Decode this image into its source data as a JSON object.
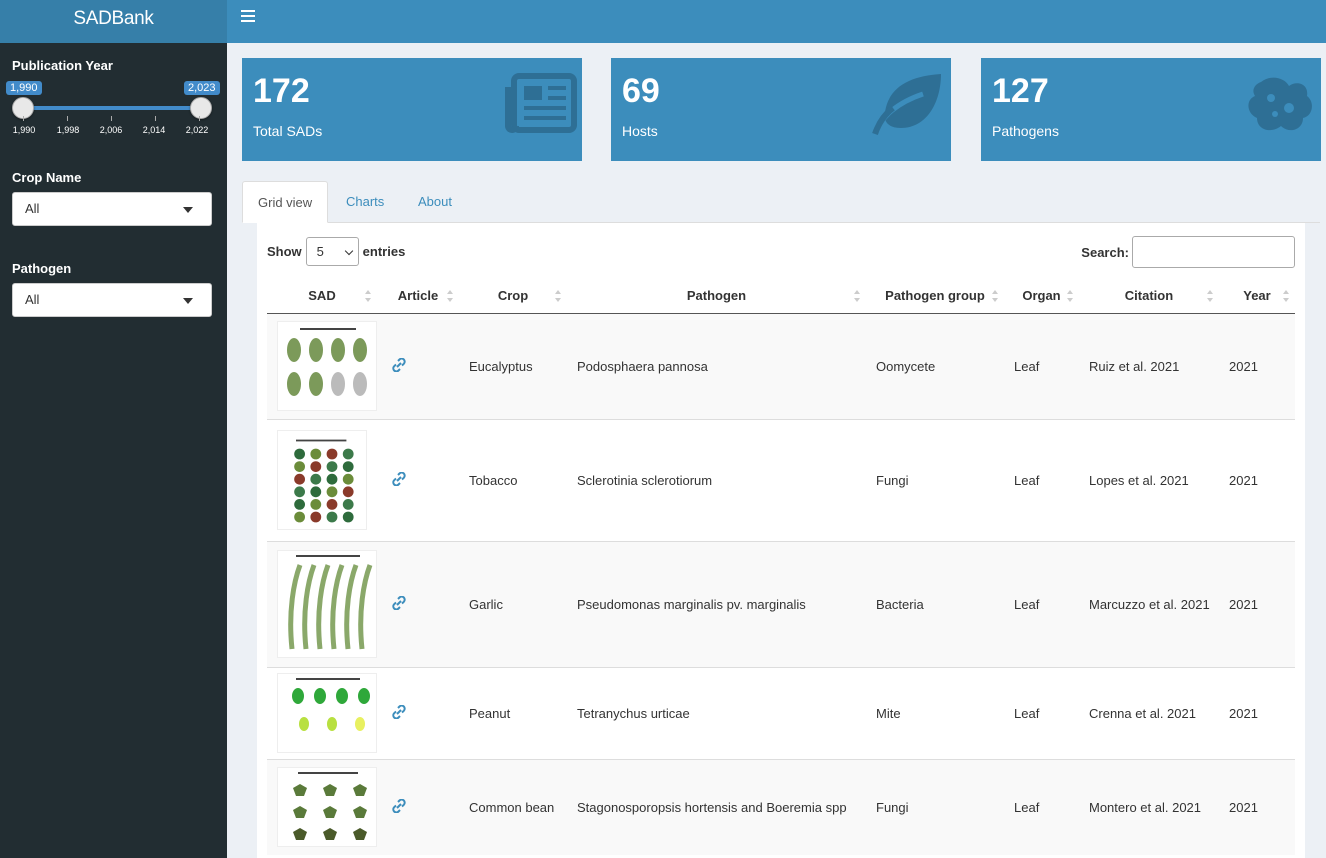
{
  "brand": "SADBank",
  "sidebar": {
    "year_label": "Publication Year",
    "year_min": "1,990",
    "year_max": "2,023",
    "ticks": [
      "1,990",
      "1,998",
      "2,006",
      "2,014",
      "2,022"
    ],
    "crop_label": "Crop Name",
    "crop_value": "All",
    "pathogen_label": "Pathogen",
    "pathogen_value": "All"
  },
  "boxes": [
    {
      "value": "172",
      "label": "Total SADs",
      "icon": "newspaper-icon"
    },
    {
      "value": "69",
      "label": "Hosts",
      "icon": "leaf-icon"
    },
    {
      "value": "127",
      "label": "Pathogens",
      "icon": "bacterium-icon"
    }
  ],
  "tabs": [
    "Grid view",
    "Charts",
    "About"
  ],
  "table": {
    "show_label": "Show",
    "entries_value": "5",
    "entries_label": "entries",
    "search_label": "Search:",
    "columns": [
      "SAD",
      "Article",
      "Crop",
      "Pathogen",
      "Pathogen group",
      "Organ",
      "Citation",
      "Year"
    ],
    "rows": [
      {
        "crop": "Eucalyptus",
        "pathogen": "Podosphaera pannosa",
        "group": "Oomycete",
        "organ": "Leaf",
        "citation": "Ruiz et al. 2021",
        "year": "2021"
      },
      {
        "crop": "Tobacco",
        "pathogen": "Sclerotinia sclerotiorum",
        "group": "Fungi",
        "organ": "Leaf",
        "citation": "Lopes et al. 2021",
        "year": "2021"
      },
      {
        "crop": "Garlic",
        "pathogen": "Pseudomonas marginalis pv. marginalis",
        "group": "Bacteria",
        "organ": "Leaf",
        "citation": "Marcuzzo et al. 2021",
        "year": "2021"
      },
      {
        "crop": "Peanut",
        "pathogen": "Tetranychus urticae",
        "group": "Mite",
        "organ": "Leaf",
        "citation": "Crenna et al. 2021",
        "year": "2021"
      },
      {
        "crop": "Common bean",
        "pathogen": "Stagonosporopsis hortensis and Boeremia spp",
        "group": "Fungi",
        "organ": "Leaf",
        "citation": "Montero et al. 2021",
        "year": "2021"
      }
    ]
  },
  "colors": {
    "header": "#3c8dbc",
    "brand": "#367fa9",
    "sidebar": "#222d32"
  }
}
